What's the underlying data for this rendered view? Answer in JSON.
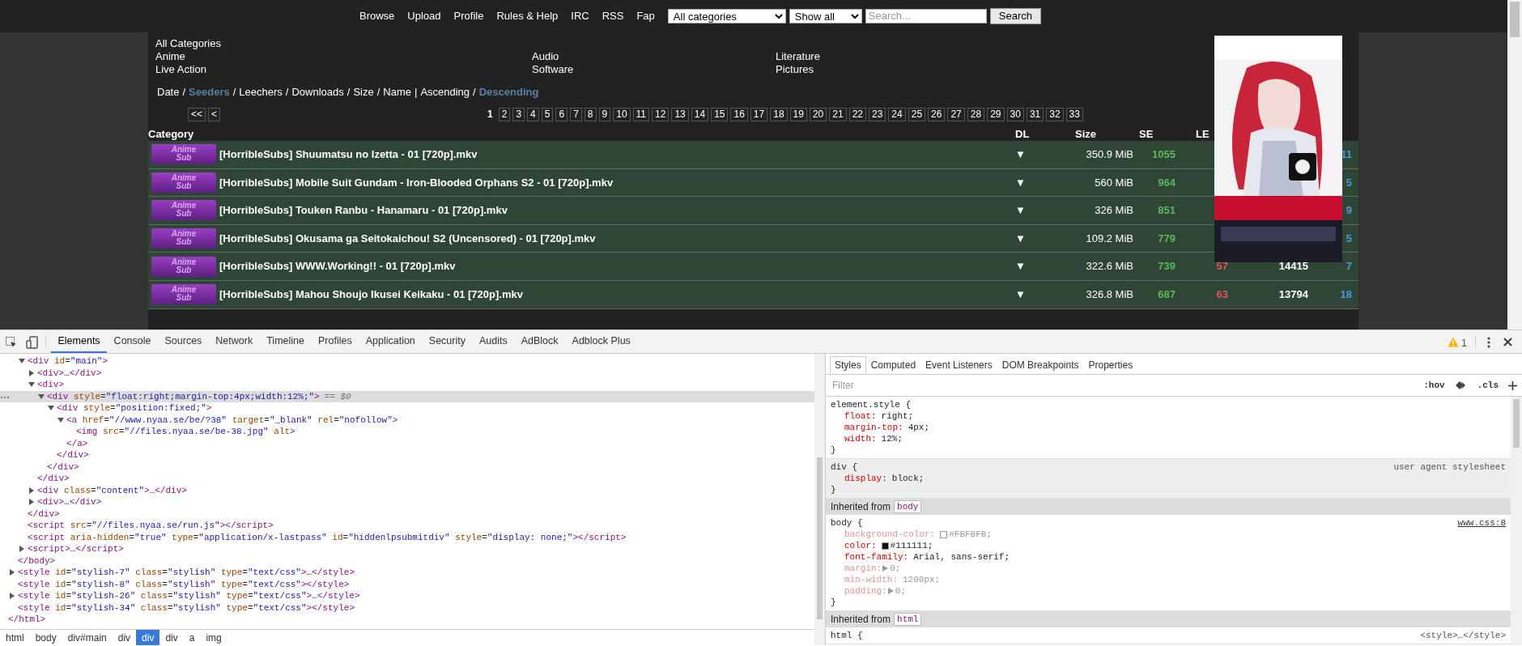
{
  "nav": {
    "links": [
      "Browse",
      "Upload",
      "Profile",
      "Rules & Help",
      "IRC",
      "RSS",
      "Fap"
    ],
    "category_select": "All categories",
    "filter_select": "Show all",
    "search": {
      "placeholder": "Search..."
    },
    "search_button": "Search"
  },
  "categories": {
    "all": "All Categories",
    "items": [
      "Anime",
      "Audio",
      "Literature",
      "Live Action",
      "Software",
      "Pictures"
    ]
  },
  "sort": {
    "field_separator": "/",
    "group_separator": "|",
    "fields": [
      {
        "label": "Date",
        "selected": false
      },
      {
        "label": "Seeders",
        "selected": true
      },
      {
        "label": "Leechers",
        "selected": false
      },
      {
        "label": "Downloads",
        "selected": false
      },
      {
        "label": "Size",
        "selected": false
      },
      {
        "label": "Name",
        "selected": false
      }
    ],
    "orders": [
      {
        "label": "Ascending",
        "selected": false
      },
      {
        "label": "Descending",
        "selected": true
      }
    ]
  },
  "pagination": {
    "nav": [
      "<<",
      "<"
    ],
    "pages": [
      {
        "label": "1",
        "selected": true
      },
      {
        "label": "2",
        "selected": false
      },
      {
        "label": "3",
        "selected": false
      },
      {
        "label": "4",
        "selected": false
      },
      {
        "label": "5",
        "selected": false
      },
      {
        "label": "6",
        "selected": false
      },
      {
        "label": "7",
        "selected": false
      },
      {
        "label": "8",
        "selected": false
      },
      {
        "label": "9",
        "selected": false
      },
      {
        "label": "10",
        "selected": false
      },
      {
        "label": "11",
        "selected": false
      },
      {
        "label": "12",
        "selected": false
      },
      {
        "label": "13",
        "selected": false
      },
      {
        "label": "14",
        "selected": false
      },
      {
        "label": "15",
        "selected": false
      },
      {
        "label": "16",
        "selected": false
      },
      {
        "label": "17",
        "selected": false
      },
      {
        "label": "18",
        "selected": false
      },
      {
        "label": "19",
        "selected": false
      },
      {
        "label": "20",
        "selected": false
      },
      {
        "label": "21",
        "selected": false
      },
      {
        "label": "22",
        "selected": false
      },
      {
        "label": "23",
        "selected": false
      },
      {
        "label": "24",
        "selected": false
      },
      {
        "label": "25",
        "selected": false
      },
      {
        "label": "26",
        "selected": false
      },
      {
        "label": "27",
        "selected": false
      },
      {
        "label": "28",
        "selected": false
      },
      {
        "label": "29",
        "selected": false
      },
      {
        "label": "30",
        "selected": false
      },
      {
        "label": "31",
        "selected": false
      },
      {
        "label": "32",
        "selected": false
      },
      {
        "label": "33",
        "selected": false
      }
    ]
  },
  "table": {
    "columns": [
      "Category",
      "DL",
      "Size",
      "SE",
      "LE"
    ],
    "rows": [
      {
        "category": "Anime Sub",
        "name": "[HorribleSubs] Shuumatsu no Izetta - 01 [720p].mkv",
        "download": "▼",
        "size": "350.9 MiB",
        "seeders": "1055",
        "comments": "11"
      },
      {
        "category": "Anime Sub",
        "name": "[HorribleSubs] Mobile Suit Gundam - Iron-Blooded Orphans S2 - 01 [720p].mkv",
        "download": "▼",
        "size": "560 MiB",
        "seeders": "964",
        "comments": "5"
      },
      {
        "category": "Anime Sub",
        "name": "[HorribleSubs] Touken Ranbu - Hanamaru - 01 [720p].mkv",
        "download": "▼",
        "size": "326 MiB",
        "seeders": "851",
        "comments": "9"
      },
      {
        "category": "Anime Sub",
        "name": "[HorribleSubs] Okusama ga Seitokaichou! S2 (Uncensored) - 01 [720p].mkv",
        "download": "▼",
        "size": "109.2 MiB",
        "seeders": "779",
        "comments": "5"
      },
      {
        "category": "Anime Sub",
        "name": "[HorribleSubs] WWW.Working!! - 01 [720p].mkv",
        "download": "▼",
        "size": "322.6 MiB",
        "seeders": "739",
        "leechers": "57",
        "downloads": "14415",
        "comments": "7"
      },
      {
        "category": "Anime Sub",
        "name": "[HorribleSubs] Mahou Shoujo Ikusei Keikaku - 01 [720p].mkv",
        "download": "▼",
        "size": "326.8 MiB",
        "seeders": "687",
        "leechers": "63",
        "downloads": "13794",
        "comments": "18"
      }
    ]
  },
  "devtools": {
    "tabs": [
      {
        "label": "Elements",
        "selected": true
      },
      {
        "label": "Console",
        "selected": false
      },
      {
        "label": "Sources",
        "selected": false
      },
      {
        "label": "Network",
        "selected": false
      },
      {
        "label": "Timeline",
        "selected": false
      },
      {
        "label": "Profiles",
        "selected": false
      },
      {
        "label": "Application",
        "selected": false
      },
      {
        "label": "Security",
        "selected": false
      },
      {
        "label": "Audits",
        "selected": false
      },
      {
        "label": "AdBlock",
        "selected": false
      },
      {
        "label": "Adblock Plus",
        "selected": false
      }
    ],
    "warnings": "1",
    "dom_tree": [
      {
        "close": "</html>",
        "selected": false,
        "children": [
          {
            "close": "</body>",
            "selected": false,
            "children": [
              {
                "open": "<div id=\"main\">",
                "close": "</div>",
                "expanded": true,
                "selected": false,
                "children": [
                  {
                    "open": "<div>…</div>",
                    "expanded": false,
                    "selected": false
                  },
                  {
                    "open": "<div>",
                    "close": "</div>",
                    "expanded": true,
                    "selected": false,
                    "children": [
                      {
                        "open": "<div style=\"float:right;margin-top:4px;width:12%;\">",
                        "suffix": "== $0",
                        "close": "</div>",
                        "expanded": true,
                        "selected": true,
                        "children": [
                          {
                            "open": "<div style=\"position:fixed;\">",
                            "close": "</div>",
                            "expanded": true,
                            "selected": false,
                            "children": [
                              {
                                "open": "<a href=\"//www.nyaa.se/be/?38\" target=\"_blank\" rel=\"nofollow\">",
                                "close": "</a>",
                                "expanded": true,
                                "selected": false,
                                "children": [
                                  {
                                    "open": "<img src=\"//files.nyaa.se/be-38.jpg\" alt>",
                                    "selected": false
                                  }
                                ]
                              }
                            ]
                          }
                        ]
                      }
                    ]
                  },
                  {
                    "open": "<div class=\"content\">…</div>",
                    "expanded": false,
                    "selected": false
                  },
                  {
                    "open": "<div>…</div>",
                    "expanded": false,
                    "selected": false
                  }
                ]
              },
              {
                "open": "<script src=\"//files.nyaa.se/run.js\"></script>",
                "selected": false
              },
              {
                "open": "<script aria-hidden=\"true\" type=\"application/x-lastpass\" id=\"hiddenlpsubmitdiv\" style=\"display: none;\"></script>",
                "selected": false
              },
              {
                "open": "<script>…</script>",
                "expanded": false,
                "selected": false
              }
            ]
          },
          {
            "open": "<style id=\"stylish-7\" class=\"stylish\" type=\"text/css\">…</style>",
            "expanded": false,
            "selected": false
          },
          {
            "open": "<style id=\"stylish-8\" class=\"stylish\" type=\"text/css\"></style>",
            "selected": false
          },
          {
            "open": "<style id=\"stylish-26\" class=\"stylish\" type=\"text/css\">…</style>",
            "expanded": false,
            "selected": false
          },
          {
            "open": "<style id=\"stylish-34\" class=\"stylish\" type=\"text/css\"></style>",
            "selected": false
          }
        ]
      }
    ],
    "breadcrumbs": [
      {
        "label": "html",
        "selected": false
      },
      {
        "label": "body",
        "selected": false
      },
      {
        "label": "div#main",
        "selected": false
      },
      {
        "label": "div",
        "selected": false
      },
      {
        "label": "div",
        "selected": true
      },
      {
        "label": "div",
        "selected": false
      },
      {
        "label": "a",
        "selected": false
      },
      {
        "label": "img",
        "selected": false
      }
    ],
    "styles": {
      "tabs": [
        {
          "label": "Styles",
          "selected": true
        },
        {
          "label": "Computed",
          "selected": false
        },
        {
          "label": "Event Listeners",
          "selected": false
        },
        {
          "label": "DOM Breakpoints",
          "selected": false
        },
        {
          "label": "Properties",
          "selected": false
        }
      ],
      "filter": {
        "placeholder": "Filter"
      },
      "tools": [
        ":hov",
        ".cls"
      ],
      "rules": [
        {
          "kind": "rule",
          "selector": "element.style {",
          "user_agent": false,
          "close": "}",
          "props": [
            {
              "name": "float:",
              "value": "right;",
              "inactive": false
            },
            {
              "name": "margin-top:",
              "value": "4px;",
              "inactive": false
            },
            {
              "name": "width:",
              "value": "12%;",
              "inactive": false
            }
          ]
        },
        {
          "kind": "rule",
          "selector": "div {",
          "source": "user agent stylesheet",
          "source_link": false,
          "user_agent": true,
          "close": "}",
          "props": [
            {
              "name": "display:",
              "value": "block;",
              "inactive": false
            }
          ]
        },
        {
          "kind": "inherited",
          "label": "Inherited from",
          "tag": "body"
        },
        {
          "kind": "rule",
          "selector": "body {",
          "source": "www.css:8",
          "source_link": true,
          "user_agent": false,
          "close": "}",
          "props": [
            {
              "name": "background-color:",
              "value": "#FBFBFB;",
              "color": "#fbfbfb",
              "inactive": true
            },
            {
              "name": "color:",
              "value": "#111111;",
              "color": "#111111",
              "inactive": false
            },
            {
              "name": "font-family:",
              "value": "Arial, sans-serif;",
              "inactive": false
            },
            {
              "name": "margin:",
              "value": "0;",
              "expandable": true,
              "inactive": true
            },
            {
              "name": "min-width:",
              "value": "1200px;",
              "inactive": true
            },
            {
              "name": "padding:",
              "value": "0;",
              "expandable": true,
              "inactive": true
            }
          ]
        },
        {
          "kind": "inherited",
          "label": "Inherited from",
          "tag": "html"
        },
        {
          "kind": "rule",
          "selector": "html {",
          "source": "<style>…</style>",
          "source_link": false,
          "user_agent": false
        }
      ]
    }
  }
}
